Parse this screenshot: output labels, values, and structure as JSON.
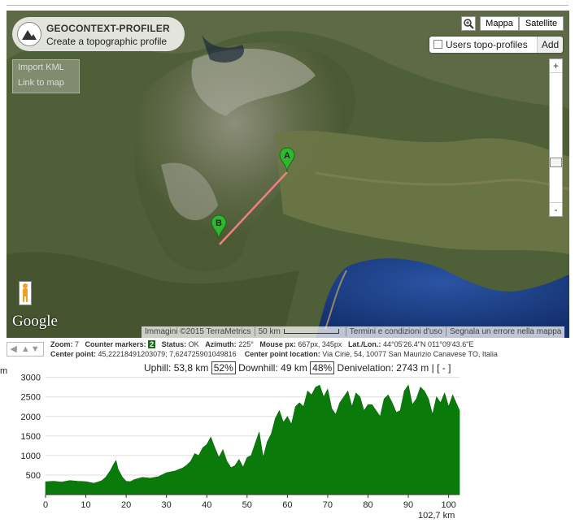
{
  "brand": {
    "title": "GEOCONTEXT-PROFILER",
    "subtitle": "Create a topographic profile",
    "logo_icon": "mountain-logo-icon"
  },
  "map_controls": {
    "import_kml": "Import KML",
    "link_to_map": "Link to map",
    "maptype_map": "Mappa",
    "maptype_satellite": "Satellite",
    "users_topo_profiles": "Users topo-profiles",
    "add": "Add",
    "zoom_in": "+",
    "zoom_out": "-",
    "google": "Google"
  },
  "markers": [
    {
      "label": "A"
    },
    {
      "label": "B"
    }
  ],
  "attribution": {
    "imagery": "Immagini ©2015 TerraMetrics",
    "scale": "50 km",
    "terms": "Termini e condizioni d'uso",
    "report": "Segnala un errore nella mappa"
  },
  "info": {
    "nav_arrows": "◀ ▲▼",
    "zoom_label": "Zoom:",
    "zoom_value": "7",
    "counter_label": "Counter markers:",
    "counter_value": "2",
    "status_label": "Status:",
    "status_value": "OK",
    "azimuth_label": "Azimuth:",
    "azimuth_value": "225°",
    "mouse_label": "Mouse px:",
    "mouse_value": "667px, 345px",
    "latlon_label": "Lat./Lon.:",
    "latlon_value": "44°05'26.4\"N 011°09'43.6\"E",
    "center_label": "Center point:",
    "center_value": "45,22218491203079; 7,624725901049816",
    "center_loc_label": "Center point location:",
    "center_loc_value": "Via Ciriè, 54, 10077 San Maurizio Canavese TO, Italia"
  },
  "stats": {
    "uphill_label": "Uphill:",
    "uphill_value": "53,8 km",
    "uphill_pct": "52%",
    "downhill_label": "Downhill:",
    "downhill_value": "49 km",
    "downhill_pct": "48%",
    "deniv_label": "Denivelation:",
    "deniv_value": "2743 m | [ - ]"
  },
  "chart_data": {
    "type": "area",
    "ylabel": "m",
    "xlabel": "102,7 km",
    "xlim": [
      0,
      102.7
    ],
    "ylim": [
      0,
      3200
    ],
    "yticks": [
      500,
      1000,
      1500,
      2000,
      2500,
      3000
    ],
    "xticks": [
      0,
      10,
      20,
      30,
      40,
      50,
      60,
      70,
      80,
      90,
      100
    ],
    "color": "#0a7a0a",
    "x": [
      0,
      2,
      4,
      6,
      8,
      10,
      12,
      13,
      14,
      15,
      16,
      17,
      17.5,
      18,
      19,
      20,
      21,
      22,
      24,
      26,
      28,
      30,
      32,
      34,
      35,
      36,
      37,
      38,
      39,
      40,
      41,
      42,
      43,
      44,
      45,
      46,
      47,
      48,
      49,
      50,
      51,
      52,
      53,
      54,
      55,
      56,
      57,
      58,
      59,
      60,
      61,
      62,
      63,
      64,
      65,
      66,
      67,
      68,
      69,
      70,
      71,
      72,
      73,
      74,
      75,
      76,
      77,
      78,
      79,
      80,
      81,
      82,
      83,
      84,
      85,
      86,
      87,
      88,
      89,
      90,
      91,
      92,
      93,
      94,
      95,
      96,
      97,
      98,
      99,
      100,
      101,
      102.7
    ],
    "y": [
      330,
      340,
      320,
      360,
      340,
      330,
      290,
      320,
      360,
      450,
      600,
      800,
      870,
      650,
      450,
      340,
      330,
      380,
      440,
      420,
      460,
      560,
      600,
      680,
      750,
      850,
      1050,
      1000,
      1200,
      1280,
      1470,
      1200,
      950,
      1150,
      850,
      690,
      740,
      900,
      700,
      950,
      1000,
      1300,
      1600,
      950,
      1350,
      1550,
      1950,
      2150,
      1850,
      2000,
      1800,
      2250,
      2350,
      2250,
      2650,
      2550,
      2750,
      2800,
      2500,
      2700,
      2200,
      2050,
      2350,
      2500,
      2650,
      2250,
      2600,
      2500,
      2150,
      2300,
      2300,
      2150,
      2000,
      2450,
      2550,
      2350,
      2100,
      2150,
      2650,
      2800,
      2300,
      2450,
      2750,
      2650,
      2450,
      2050,
      2500,
      2350,
      2600,
      2250,
      2550,
      2150,
      2400,
      2200,
      2250,
      2300,
      3000,
      2600,
      2950,
      2550,
      2750,
      2250,
      2400,
      2150,
      2300,
      2200
    ]
  }
}
